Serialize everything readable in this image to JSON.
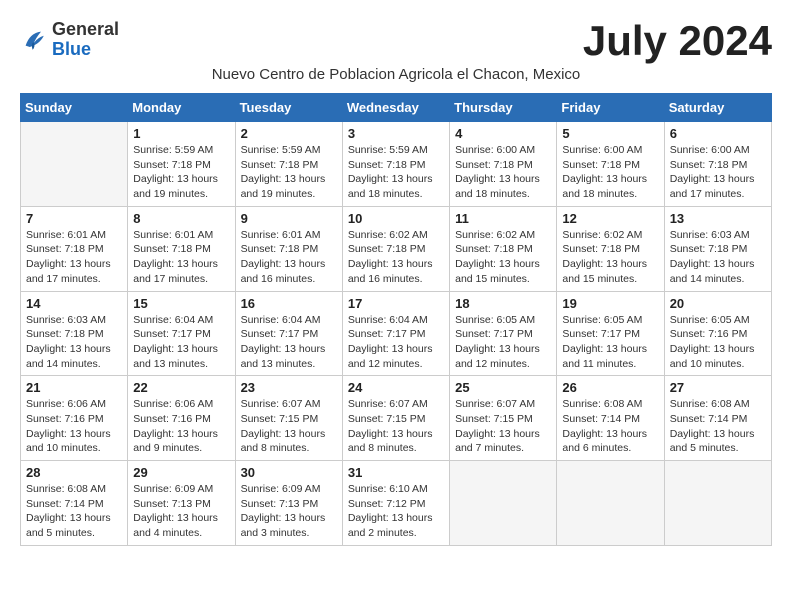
{
  "header": {
    "logo": {
      "general": "General",
      "blue": "Blue"
    },
    "title": "July 2024",
    "subtitle": "Nuevo Centro de Poblacion Agricola el Chacon, Mexico"
  },
  "weekdays": [
    "Sunday",
    "Monday",
    "Tuesday",
    "Wednesday",
    "Thursday",
    "Friday",
    "Saturday"
  ],
  "weeks": [
    [
      {
        "day": "",
        "sunrise": "",
        "sunset": "",
        "daylight": ""
      },
      {
        "day": "1",
        "sunrise": "Sunrise: 5:59 AM",
        "sunset": "Sunset: 7:18 PM",
        "daylight": "Daylight: 13 hours and 19 minutes."
      },
      {
        "day": "2",
        "sunrise": "Sunrise: 5:59 AM",
        "sunset": "Sunset: 7:18 PM",
        "daylight": "Daylight: 13 hours and 19 minutes."
      },
      {
        "day": "3",
        "sunrise": "Sunrise: 5:59 AM",
        "sunset": "Sunset: 7:18 PM",
        "daylight": "Daylight: 13 hours and 18 minutes."
      },
      {
        "day": "4",
        "sunrise": "Sunrise: 6:00 AM",
        "sunset": "Sunset: 7:18 PM",
        "daylight": "Daylight: 13 hours and 18 minutes."
      },
      {
        "day": "5",
        "sunrise": "Sunrise: 6:00 AM",
        "sunset": "Sunset: 7:18 PM",
        "daylight": "Daylight: 13 hours and 18 minutes."
      },
      {
        "day": "6",
        "sunrise": "Sunrise: 6:00 AM",
        "sunset": "Sunset: 7:18 PM",
        "daylight": "Daylight: 13 hours and 17 minutes."
      }
    ],
    [
      {
        "day": "7",
        "sunrise": "Sunrise: 6:01 AM",
        "sunset": "Sunset: 7:18 PM",
        "daylight": "Daylight: 13 hours and 17 minutes."
      },
      {
        "day": "8",
        "sunrise": "Sunrise: 6:01 AM",
        "sunset": "Sunset: 7:18 PM",
        "daylight": "Daylight: 13 hours and 17 minutes."
      },
      {
        "day": "9",
        "sunrise": "Sunrise: 6:01 AM",
        "sunset": "Sunset: 7:18 PM",
        "daylight": "Daylight: 13 hours and 16 minutes."
      },
      {
        "day": "10",
        "sunrise": "Sunrise: 6:02 AM",
        "sunset": "Sunset: 7:18 PM",
        "daylight": "Daylight: 13 hours and 16 minutes."
      },
      {
        "day": "11",
        "sunrise": "Sunrise: 6:02 AM",
        "sunset": "Sunset: 7:18 PM",
        "daylight": "Daylight: 13 hours and 15 minutes."
      },
      {
        "day": "12",
        "sunrise": "Sunrise: 6:02 AM",
        "sunset": "Sunset: 7:18 PM",
        "daylight": "Daylight: 13 hours and 15 minutes."
      },
      {
        "day": "13",
        "sunrise": "Sunrise: 6:03 AM",
        "sunset": "Sunset: 7:18 PM",
        "daylight": "Daylight: 13 hours and 14 minutes."
      }
    ],
    [
      {
        "day": "14",
        "sunrise": "Sunrise: 6:03 AM",
        "sunset": "Sunset: 7:18 PM",
        "daylight": "Daylight: 13 hours and 14 minutes."
      },
      {
        "day": "15",
        "sunrise": "Sunrise: 6:04 AM",
        "sunset": "Sunset: 7:17 PM",
        "daylight": "Daylight: 13 hours and 13 minutes."
      },
      {
        "day": "16",
        "sunrise": "Sunrise: 6:04 AM",
        "sunset": "Sunset: 7:17 PM",
        "daylight": "Daylight: 13 hours and 13 minutes."
      },
      {
        "day": "17",
        "sunrise": "Sunrise: 6:04 AM",
        "sunset": "Sunset: 7:17 PM",
        "daylight": "Daylight: 13 hours and 12 minutes."
      },
      {
        "day": "18",
        "sunrise": "Sunrise: 6:05 AM",
        "sunset": "Sunset: 7:17 PM",
        "daylight": "Daylight: 13 hours and 12 minutes."
      },
      {
        "day": "19",
        "sunrise": "Sunrise: 6:05 AM",
        "sunset": "Sunset: 7:17 PM",
        "daylight": "Daylight: 13 hours and 11 minutes."
      },
      {
        "day": "20",
        "sunrise": "Sunrise: 6:05 AM",
        "sunset": "Sunset: 7:16 PM",
        "daylight": "Daylight: 13 hours and 10 minutes."
      }
    ],
    [
      {
        "day": "21",
        "sunrise": "Sunrise: 6:06 AM",
        "sunset": "Sunset: 7:16 PM",
        "daylight": "Daylight: 13 hours and 10 minutes."
      },
      {
        "day": "22",
        "sunrise": "Sunrise: 6:06 AM",
        "sunset": "Sunset: 7:16 PM",
        "daylight": "Daylight: 13 hours and 9 minutes."
      },
      {
        "day": "23",
        "sunrise": "Sunrise: 6:07 AM",
        "sunset": "Sunset: 7:15 PM",
        "daylight": "Daylight: 13 hours and 8 minutes."
      },
      {
        "day": "24",
        "sunrise": "Sunrise: 6:07 AM",
        "sunset": "Sunset: 7:15 PM",
        "daylight": "Daylight: 13 hours and 8 minutes."
      },
      {
        "day": "25",
        "sunrise": "Sunrise: 6:07 AM",
        "sunset": "Sunset: 7:15 PM",
        "daylight": "Daylight: 13 hours and 7 minutes."
      },
      {
        "day": "26",
        "sunrise": "Sunrise: 6:08 AM",
        "sunset": "Sunset: 7:14 PM",
        "daylight": "Daylight: 13 hours and 6 minutes."
      },
      {
        "day": "27",
        "sunrise": "Sunrise: 6:08 AM",
        "sunset": "Sunset: 7:14 PM",
        "daylight": "Daylight: 13 hours and 5 minutes."
      }
    ],
    [
      {
        "day": "28",
        "sunrise": "Sunrise: 6:08 AM",
        "sunset": "Sunset: 7:14 PM",
        "daylight": "Daylight: 13 hours and 5 minutes."
      },
      {
        "day": "29",
        "sunrise": "Sunrise: 6:09 AM",
        "sunset": "Sunset: 7:13 PM",
        "daylight": "Daylight: 13 hours and 4 minutes."
      },
      {
        "day": "30",
        "sunrise": "Sunrise: 6:09 AM",
        "sunset": "Sunset: 7:13 PM",
        "daylight": "Daylight: 13 hours and 3 minutes."
      },
      {
        "day": "31",
        "sunrise": "Sunrise: 6:10 AM",
        "sunset": "Sunset: 7:12 PM",
        "daylight": "Daylight: 13 hours and 2 minutes."
      },
      {
        "day": "",
        "sunrise": "",
        "sunset": "",
        "daylight": ""
      },
      {
        "day": "",
        "sunrise": "",
        "sunset": "",
        "daylight": ""
      },
      {
        "day": "",
        "sunrise": "",
        "sunset": "",
        "daylight": ""
      }
    ]
  ]
}
